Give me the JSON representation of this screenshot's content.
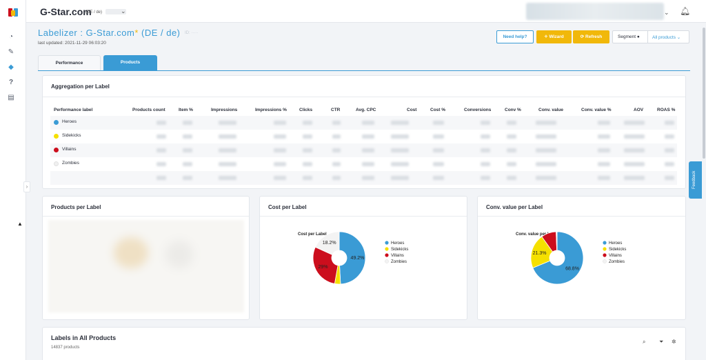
{
  "topbar": {
    "shop_name": "G-Star.com",
    "shop_sub": "(DE / de)"
  },
  "header": {
    "title": "Labelizer : G-Star.com",
    "title_suffix": " (DE / de)",
    "last_updated": "last updated:  2021-11-29 06:03:20"
  },
  "actions": {
    "help": "Need help?",
    "wizard": "Wizard",
    "refresh": "Refresh",
    "segment_label": "Segment",
    "segment_value": "All products"
  },
  "tabs": [
    "Performance",
    "Products"
  ],
  "aggregation": {
    "title": "Aggregation per Label",
    "columns": [
      "Performance label",
      "Products count",
      "Item %",
      "Impressions",
      "Impressions %",
      "Clicks",
      "CTR",
      "Avg. CPC",
      "Cost",
      "Cost %",
      "Conversions",
      "Conv %",
      "Conv. value",
      "Conv. value %",
      "AOV",
      "ROAS %"
    ],
    "rows": [
      {
        "label": "Heroes",
        "color": "#3a9bd5"
      },
      {
        "label": "Sidekicks",
        "color": "#f5e000"
      },
      {
        "label": "Villains",
        "color": "#cc0e1d"
      },
      {
        "label": "Zombies",
        "color": "#f0f0f0"
      }
    ]
  },
  "products_per_label": {
    "title": "Products per Label"
  },
  "cost_per_label": {
    "title": "Cost per Label"
  },
  "conv_per_label": {
    "title": "Conv. value per Label"
  },
  "chart_data": [
    {
      "type": "pie",
      "title": "Cost per Label",
      "categories": [
        "Heroes",
        "Sidekicks",
        "Villains",
        "Zombies"
      ],
      "values": [
        49.2,
        3.6,
        29.0,
        18.2
      ],
      "value_labels": [
        "49.2%",
        "",
        "29%",
        "18.2%"
      ],
      "colors": [
        "#3a9bd5",
        "#f5e000",
        "#cc0e1d",
        "#f3f3f3"
      ],
      "legend": "right"
    },
    {
      "type": "pie",
      "title": "Conv. value per Label",
      "categories": [
        "Heroes",
        "Sidekicks",
        "Villains",
        "Zombies"
      ],
      "values": [
        68.8,
        21.3,
        9.3,
        0.6
      ],
      "value_labels": [
        "68.8%",
        "21.3%",
        "",
        ""
      ],
      "colors": [
        "#3a9bd5",
        "#f5e000",
        "#cc0e1d",
        "#f3f3f3"
      ],
      "legend": "right"
    }
  ],
  "labels_section": {
    "title": "Labels in All Products",
    "count": "14837 products"
  },
  "feedback": "Feedback",
  "icons": {
    "rail": [
      "dashboard-icon",
      "pencil-icon",
      "tag-icon",
      "help-icon",
      "trash-icon"
    ]
  }
}
